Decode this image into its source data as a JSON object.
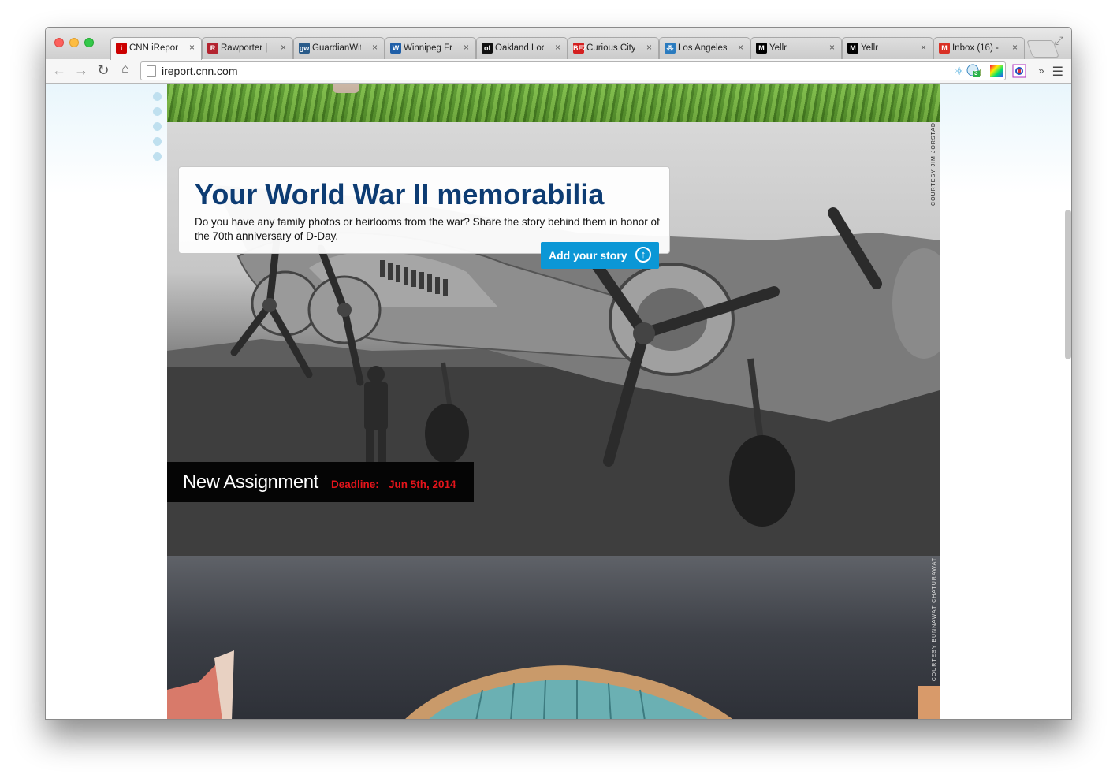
{
  "browser": {
    "tabs": [
      {
        "title": "CNN iReport",
        "favicon_text": "i",
        "favicon_color": "#cc0000",
        "active": true
      },
      {
        "title": "Rawporter |",
        "favicon_text": "R",
        "favicon_color": "#b3232f",
        "active": false
      },
      {
        "title": "GuardianWit",
        "favicon_text": "gw",
        "favicon_color": "#2b5c8a",
        "active": false
      },
      {
        "title": "Winnipeg Fr",
        "favicon_text": "W",
        "favicon_color": "#1f5fa8",
        "active": false
      },
      {
        "title": "Oakland Loc",
        "favicon_text": "ol",
        "favicon_color": "#111111",
        "active": false
      },
      {
        "title": "Curious City",
        "favicon_text": "BEZ",
        "favicon_color": "#d42020",
        "active": false
      },
      {
        "title": "Los Angeles",
        "favicon_text": "⁂",
        "favicon_color": "#2a7bbf",
        "active": false
      },
      {
        "title": "Yellr",
        "favicon_text": "M",
        "favicon_color": "#000000",
        "active": false
      },
      {
        "title": "Yellr",
        "favicon_text": "M",
        "favicon_color": "#000000",
        "active": false
      },
      {
        "title": "Inbox (16) -",
        "favicon_text": "M",
        "favicon_color": "#d93025",
        "active": false
      }
    ],
    "tab_close_glyph": "×",
    "url": "ireport.cnn.com",
    "extensions_badge": "3",
    "overflow_glyph": "»",
    "menu_glyph": "☰"
  },
  "page": {
    "assignment_title": "Your World War II memorabilia",
    "assignment_description": "Do you have any family photos or heirlooms from the war? Share the story behind them in honor of the 70th anniversary of D-Day.",
    "add_story_label": "Add your story",
    "new_assignment_label": "New Assignment",
    "deadline_label": "Deadline:",
    "deadline_date": "Jun 5th, 2014",
    "photo_credit_1": "COURTESY JIM JORSTAD",
    "photo_credit_2": "COURTESY BUNNAWAT CHATURAWAT",
    "colors": {
      "title_blue": "#0d3c73",
      "button_blue": "#0b97d6",
      "deadline_red": "#e4141b"
    }
  }
}
